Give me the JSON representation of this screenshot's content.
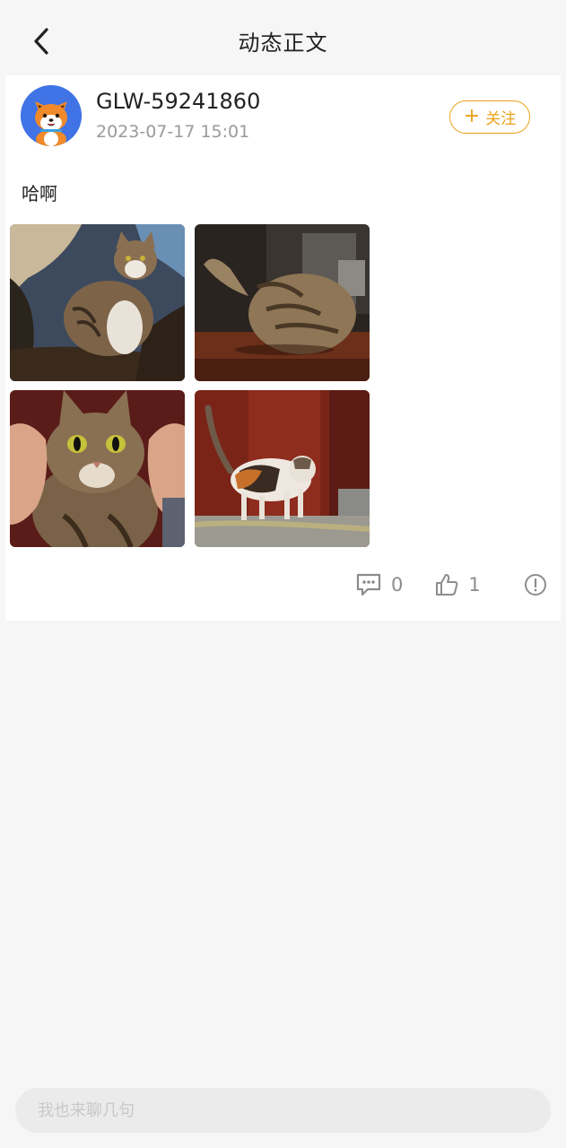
{
  "header": {
    "title": "动态正文",
    "back_icon": "chevron-left-icon"
  },
  "post": {
    "username": "GLW-59241860",
    "timestamp": "2023-07-17 15:01",
    "follow_label": "关注",
    "text": "哈啊",
    "images": [
      {
        "subject": "tabby cat sitting on tree branch"
      },
      {
        "subject": "tabby cat lying on wooden table, back view"
      },
      {
        "subject": "tabby cat held by hands"
      },
      {
        "subject": "calico cat walking"
      }
    ],
    "comment_count": "0",
    "like_count": "1",
    "icons": {
      "comment": "comment-icon",
      "like": "thumbs-up-icon",
      "report": "report-icon"
    }
  },
  "comment_bar": {
    "placeholder": "我也来聊几句"
  },
  "colors": {
    "accent": "#e9a21c",
    "avatar_bg": "#3f73e6",
    "page_bg": "#f6f6f6"
  }
}
